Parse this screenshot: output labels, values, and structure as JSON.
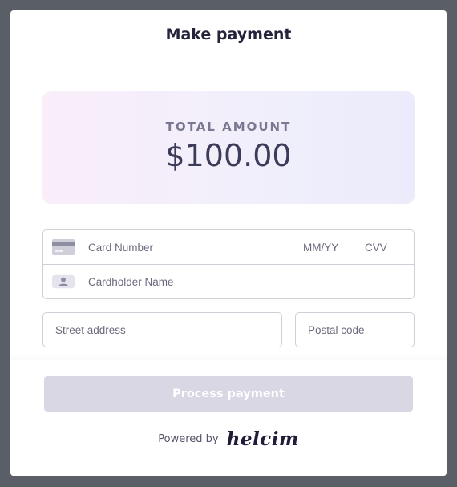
{
  "header": {
    "title": "Make payment"
  },
  "amount": {
    "label": "TOTAL AMOUNT",
    "value": "$100.00"
  },
  "card_fields": {
    "card_number_placeholder": "Card Number",
    "expiry_placeholder": "MM/YY",
    "cvv_placeholder": "CVV",
    "cardholder_placeholder": "Cardholder Name"
  },
  "address_fields": {
    "street_placeholder": "Street address",
    "postal_placeholder": "Postal code"
  },
  "footer": {
    "process_label": "Process payment",
    "powered_by": "Powered by",
    "brand": "helcim"
  },
  "icons": {
    "card": "credit-card-icon",
    "person": "person-icon"
  },
  "colors": {
    "button_disabled": "#d8d7e3",
    "backdrop": "#5a5e66",
    "title": "#25233c"
  }
}
